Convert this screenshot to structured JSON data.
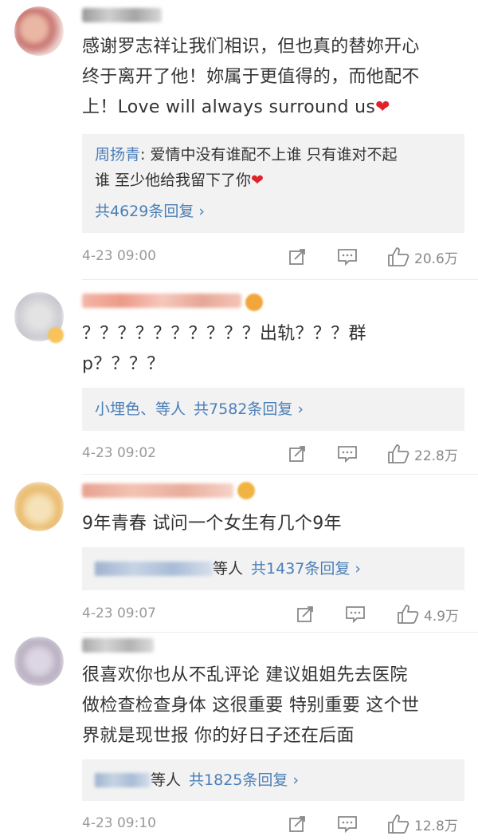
{
  "comments": [
    {
      "text": "感谢罗志祥让我们相识，但也真的替妳开心终于离开了他！妳属于更值得的，而他配不上！Love will always surround us",
      "text_lines": [
        "感谢罗志祥让我们相识，但也真的替妳开心",
        "终于离开了他！妳属于更值得的，而他配不",
        "上！Love will always surround us"
      ],
      "heart": "❤",
      "reply": {
        "author": "周扬青",
        "separator": ": ",
        "lines": [
          "爱情中没有谁配不上谁 只有谁对不起",
          "谁 至少他给我留下了你"
        ],
        "heart": "❤",
        "count": "共4629条回复 ›"
      },
      "time": "4-23 09:00",
      "likes": "20.6万"
    },
    {
      "text_lines": [
        "？？？？？？？？？？出轨？？？群",
        "p？？？？"
      ],
      "reply": {
        "names": "小埋色、等人",
        "count": "共7582条回复 ›"
      },
      "time": "4-23 09:02",
      "likes": "22.8万"
    },
    {
      "text_lines": [
        "9年青春 试问一个女生有几个9年"
      ],
      "reply": {
        "suffix": "等人",
        "count": "共1437条回复 ›"
      },
      "time": "4-23 09:07",
      "likes": "4.9万"
    },
    {
      "text_lines": [
        "很喜欢你也从不乱评论 建议姐姐先去医院",
        "做检查检查身体 这很重要 特别重要 这个世",
        "界就是现世报 你的好日子还在后面"
      ],
      "reply": {
        "suffix": "等人",
        "count": "共1825条回复 ›"
      },
      "time": "4-23 09:10",
      "likes": "12.8万"
    }
  ],
  "colors": {
    "link": "#4a7eb8",
    "heart": "#e0232a",
    "muted": "#999999",
    "reply_bg": "#f2f2f2"
  },
  "icons": [
    "share-icon",
    "comment-icon",
    "like-icon"
  ]
}
